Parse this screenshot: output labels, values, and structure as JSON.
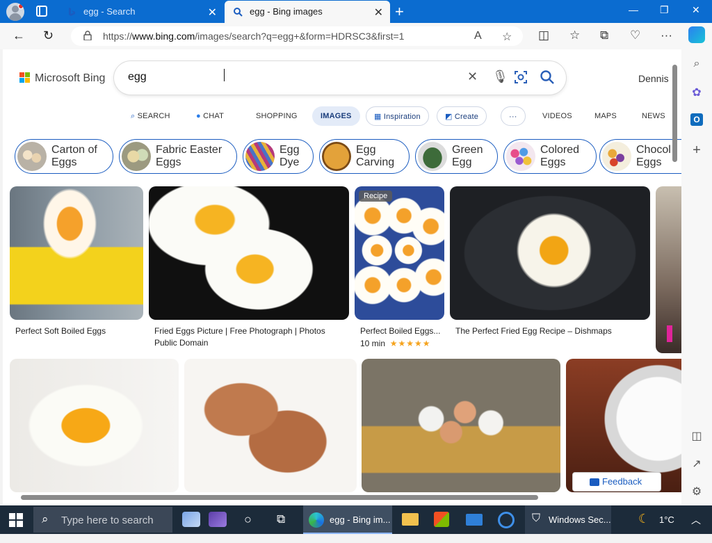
{
  "browser": {
    "tabs": [
      {
        "label": "egg - Search"
      },
      {
        "label": "egg - Bing images"
      }
    ],
    "url_prefix": "https://",
    "url_domain": "www.bing.com",
    "url_path": "/images/search?q=egg+&form=HDRSC3&first=1"
  },
  "bing": {
    "logo_text": "Microsoft Bing",
    "query": "egg",
    "user_name": "Dennis",
    "scopes": [
      {
        "label": "SEARCH"
      },
      {
        "label": "CHAT"
      },
      {
        "label": "SHOPPING"
      },
      {
        "label": "IMAGES"
      },
      {
        "label": "Inspiration"
      },
      {
        "label": "Create"
      },
      {
        "label": "···"
      },
      {
        "label": "VIDEOS"
      },
      {
        "label": "MAPS"
      },
      {
        "label": "NEWS"
      }
    ],
    "chips": [
      {
        "line1": "Carton of",
        "line2": "Eggs"
      },
      {
        "line1": "Fabric Easter",
        "line2": "Eggs"
      },
      {
        "line1": "Egg",
        "line2": "Dye"
      },
      {
        "line1": "Egg",
        "line2": "Carving"
      },
      {
        "line1": "Green",
        "line2": "Egg"
      },
      {
        "line1": "Colored",
        "line2": "Eggs"
      },
      {
        "line1": "Chocol",
        "line2": "Eggs"
      }
    ],
    "results": [
      {
        "caption": "Perfect Soft Boiled Eggs"
      },
      {
        "caption": "Fried Eggs Picture | Free Photograph | Photos Public Domain"
      },
      {
        "caption": "Perfect Boiled Eggs...",
        "badge": "Recipe",
        "time": "10 min",
        "stars": "★★★★★"
      },
      {
        "caption": "The Perfect Fried Egg Recipe – Dishmaps"
      }
    ],
    "feedback_label": "Feedback"
  },
  "taskbar": {
    "search_placeholder": "Type here to search",
    "edge_label": "egg - Bing im...",
    "security_label": "Windows Sec...",
    "weather": "1°C"
  }
}
